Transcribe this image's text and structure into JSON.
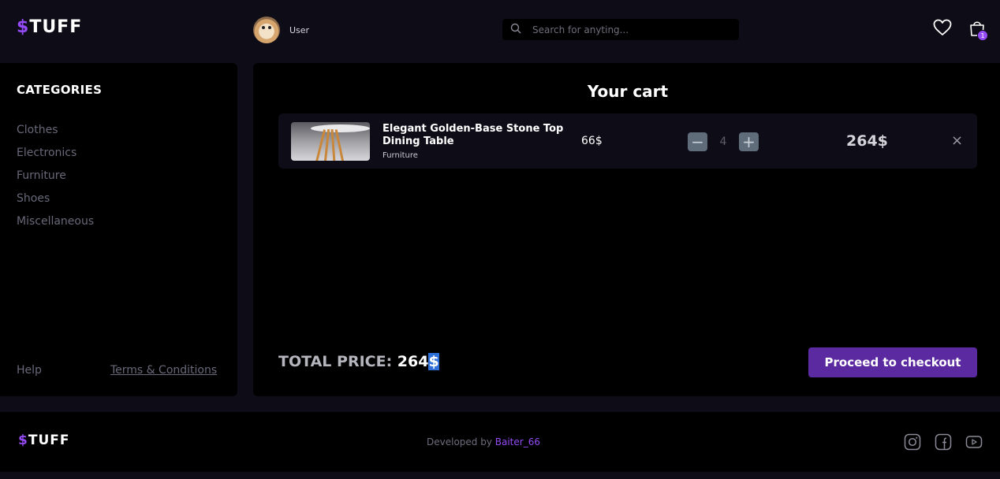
{
  "header": {
    "logo_symbol": "$",
    "logo_text": "TUFF",
    "user_name": "User",
    "search_placeholder": "Search for anyting...",
    "cart_count": "1"
  },
  "sidebar": {
    "title": "CATEGORIES",
    "categories": [
      "Clothes",
      "Electronics",
      "Furniture",
      "Shoes",
      "Miscellaneous"
    ],
    "help": "Help",
    "terms": "Terms & Conditions"
  },
  "cart": {
    "title": "Your cart",
    "items": [
      {
        "name": "Elegant Golden-Base Stone Top Dining Table",
        "category": "Furniture",
        "price": "66$",
        "quantity": "4",
        "total": "264$",
        "minus": "−",
        "plus": "+",
        "remove": "×"
      }
    ],
    "total_label": "TOTAL PRICE: ",
    "total_value": "264",
    "total_currency": "$",
    "checkout_label": "Proceed to checkout"
  },
  "footer": {
    "logo_symbol": "$",
    "logo_text": "TUFF",
    "developed_by": "Developed by ",
    "developer": "Baiter_66"
  },
  "icons": {
    "search": "search-icon",
    "favorites": "heart-icon",
    "cart": "shopping-bag-icon",
    "remove": "close-icon",
    "instagram": "instagram-icon",
    "facebook": "facebook-icon",
    "youtube": "youtube-icon"
  },
  "colors": {
    "accent": "#944bf5",
    "checkout_button": "#5c2aa0",
    "background": "#0e0d17",
    "panel": "#000000"
  }
}
